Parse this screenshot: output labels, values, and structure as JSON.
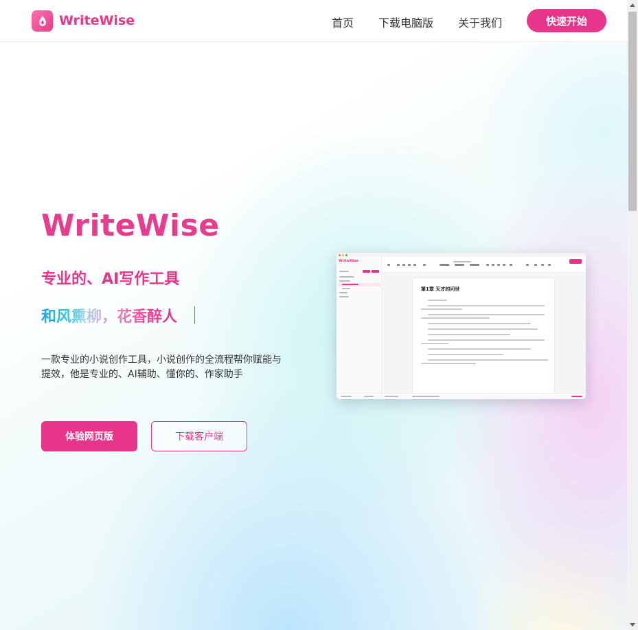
{
  "header": {
    "brand": "WriteWise",
    "nav": [
      "首页",
      "下载电脑版",
      "关于我们"
    ],
    "cta_label": "快速开始"
  },
  "hero": {
    "title": "WriteWise",
    "subtitle": "专业的、AI写作工具",
    "tagline": "和风熏柳，花香醉人",
    "description": "一款专业的小说创作工具，小说创作的全流程帮你赋能与提效，他是专业的、AI辅助、懂你的、作家助手",
    "primary_button": "体验网页版",
    "secondary_button": "下载客户端"
  },
  "preview": {
    "app_logo": "WriteWise",
    "chapter_title": "第1章  天才的问世"
  },
  "colors": {
    "brand_pink": "#e8358c",
    "text": "#333333"
  },
  "icons": {
    "logo": "writewise-pen-icon"
  }
}
